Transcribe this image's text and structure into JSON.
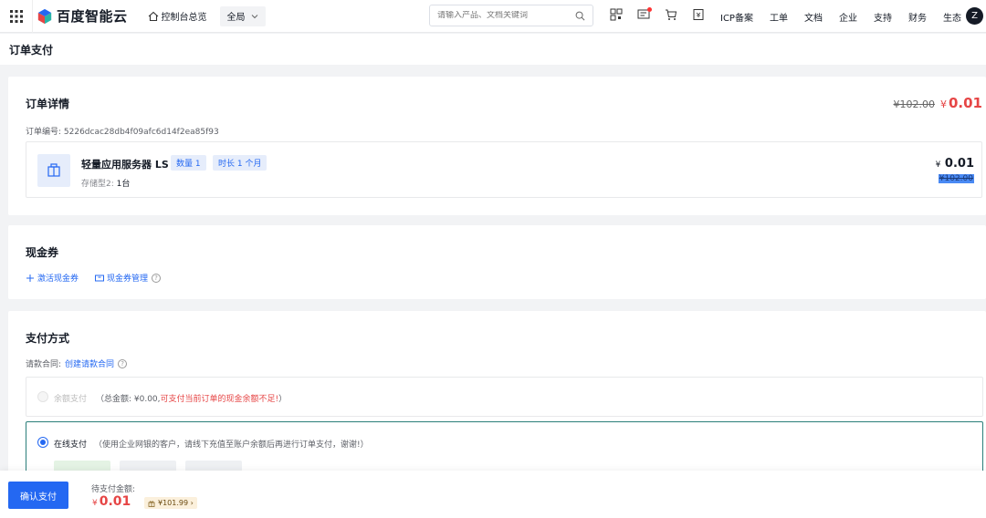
{
  "header": {
    "logo_text": "百度智能云",
    "console_label": "控制台总览",
    "region_label": "全局",
    "search_placeholder": "请输入产品、文档关键词",
    "links": [
      "ICP备案",
      "工单",
      "文档",
      "企业",
      "支持",
      "财务",
      "生态"
    ],
    "avatar_initial": "Z"
  },
  "page": {
    "title": "订单支付"
  },
  "order": {
    "title": "订单详情",
    "original_price": "¥102.00",
    "currency": "¥",
    "price": "0.01",
    "order_no": "订单编号: 5226dcac28db4f09afc6d14f2ea85f93",
    "product": {
      "name": "轻量应用服务器 LS",
      "tag_qty": "数量 1",
      "tag_duration": "时长 1 个月",
      "spec_label": "存储型2:",
      "spec_value": "1台",
      "currency": "¥",
      "price": "0.01",
      "original_price": "¥102.00"
    }
  },
  "coupon": {
    "title": "现金券",
    "activate_label": "激活现金券",
    "manage_label": "现金券管理",
    "help": "?"
  },
  "payment": {
    "title": "支付方式",
    "contract_label": "请款合同:",
    "contract_link": "创建请款合同",
    "help": "?",
    "balance": {
      "label": "余额支付",
      "desc_prefix": "（总金额: ¥0.00,",
      "desc_warning": "可支付当前订单的现金余额不足!",
      "desc_suffix": "）"
    },
    "online": {
      "label": "在线支付",
      "desc": "（使用企业网银的客户，请线下充值至账户余额后再进行订单支付，谢谢!）"
    }
  },
  "footer": {
    "confirm_label": "确认支付",
    "due_label": "待支付金额:",
    "currency": "¥",
    "due_amount": "0.01",
    "saving_label": "¥101.99",
    "saving_arrow": "›"
  },
  "colors": {
    "primary": "#2468f2",
    "price_red": "#e64545",
    "selected_border": "#2b7e7a"
  }
}
